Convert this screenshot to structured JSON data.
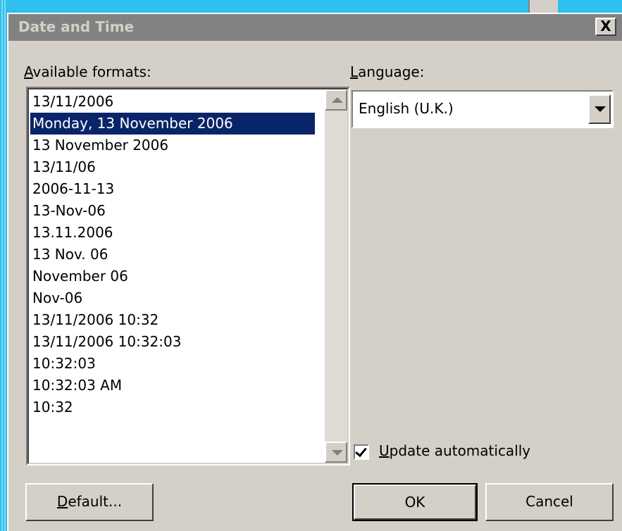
{
  "dialog": {
    "title": "Date and Time",
    "close_label": "X"
  },
  "formats": {
    "label_access": "A",
    "label_rest": "vailable formats:",
    "items": [
      "13/11/2006",
      "Monday, 13 November 2006",
      "13 November 2006",
      "13/11/06",
      "2006-11-13",
      "13-Nov-06",
      "13.11.2006",
      "13 Nov. 06",
      "November 06",
      "Nov-06",
      "13/11/2006 10:32",
      "13/11/2006 10:32:03",
      "10:32:03",
      "10:32:03 AM",
      "10:32"
    ],
    "selected_index": 1
  },
  "language": {
    "label_access": "L",
    "label_rest": "anguage:",
    "value": "English (U.K.)"
  },
  "update": {
    "checked": true,
    "label_access": "U",
    "label_rest": "pdate automatically"
  },
  "buttons": {
    "default_access": "D",
    "default_rest": "efault...",
    "ok": "OK",
    "cancel": "Cancel"
  }
}
